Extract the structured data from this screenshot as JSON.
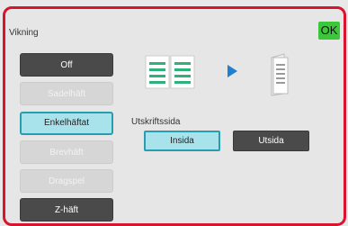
{
  "dialog": {
    "title": "Vikning",
    "ok_label": "OK"
  },
  "fold_options": [
    {
      "label": "Off",
      "state": "normal"
    },
    {
      "label": "Sadelhäft",
      "state": "disabled"
    },
    {
      "label": "Enkelhäftat",
      "state": "selected"
    },
    {
      "label": "Brevhäft",
      "state": "disabled"
    },
    {
      "label": "Dragspel",
      "state": "disabled"
    },
    {
      "label": "Z-häft",
      "state": "normal"
    }
  ],
  "print_side": {
    "label": "Utskriftssida",
    "options": [
      {
        "label": "Insida",
        "state": "selected"
      },
      {
        "label": "Utsida",
        "state": "normal"
      }
    ]
  },
  "colors": {
    "frame_border": "#d9142e",
    "ok_button": "#3cc63c",
    "selected_fill": "#a8e3ec",
    "selected_border": "#2a9caf",
    "dark_button": "#4a4a4a",
    "arrow": "#1f7fd0",
    "page_green": "#2fb27a"
  },
  "icons": [
    "open-spread-icon",
    "arrow-right-icon",
    "folded-sheet-icon"
  ]
}
